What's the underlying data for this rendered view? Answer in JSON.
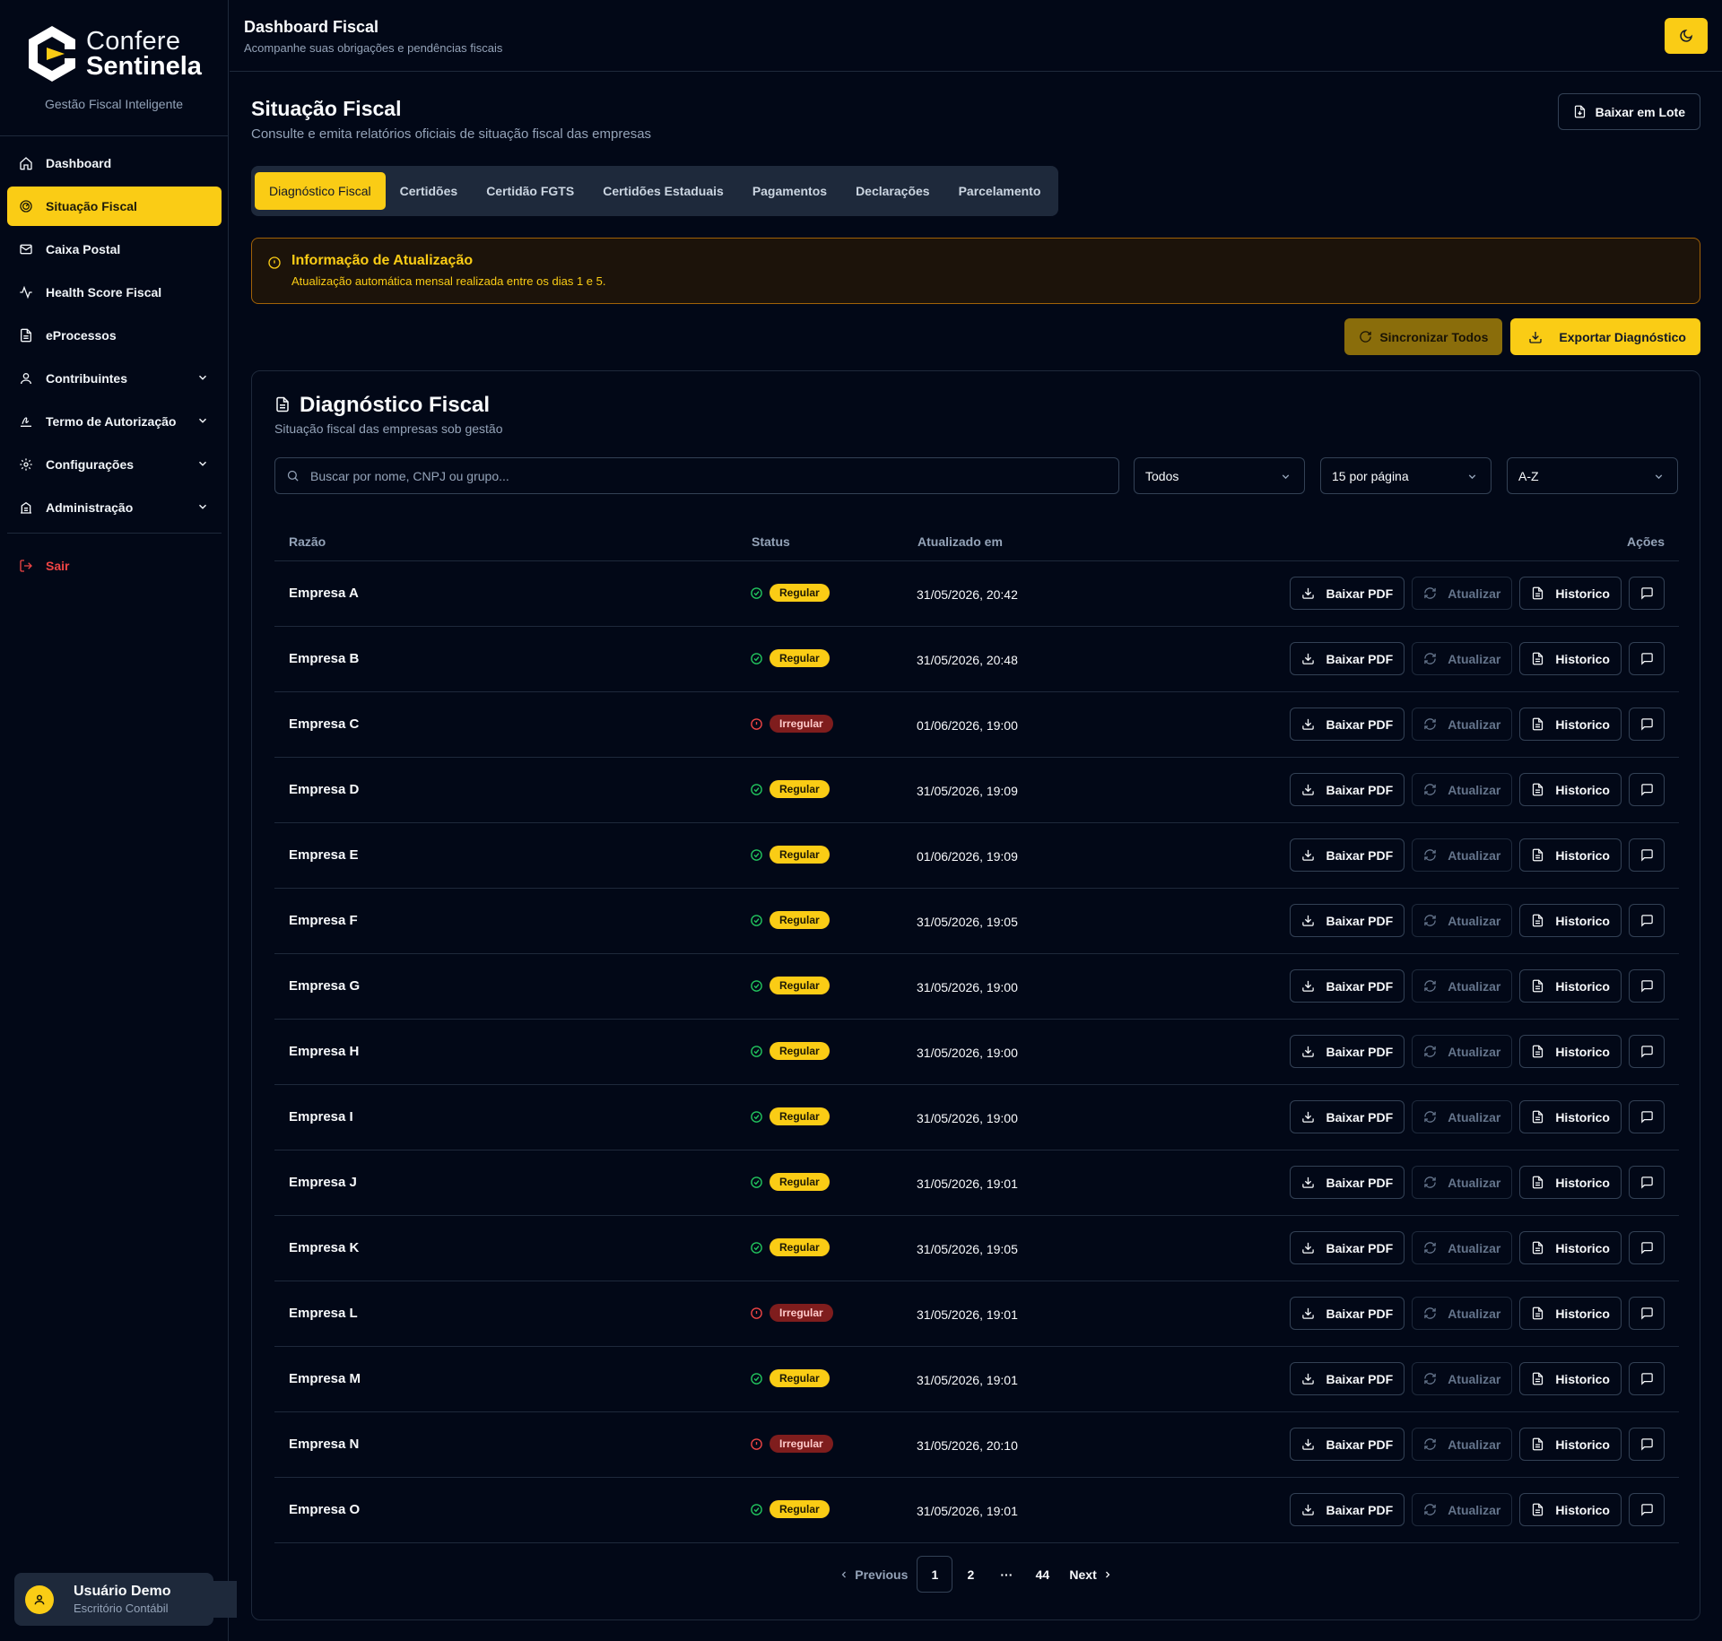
{
  "brand": {
    "line1": "Confere",
    "line2": "Sentinela",
    "tagline": "Gestão Fiscal Inteligente"
  },
  "sidebar": {
    "items": [
      {
        "label": "Dashboard",
        "icon": "home-icon"
      },
      {
        "label": "Situação Fiscal",
        "icon": "gauge-icon",
        "active": true
      },
      {
        "label": "Caixa Postal",
        "icon": "mail-icon"
      },
      {
        "label": "Health Score Fiscal",
        "icon": "activity-icon"
      },
      {
        "label": "eProcessos",
        "icon": "file-icon"
      },
      {
        "label": "Contribuintes",
        "icon": "user-icon",
        "expandable": true
      },
      {
        "label": "Termo de Autorização",
        "icon": "signature-icon",
        "expandable": true
      },
      {
        "label": "Configurações",
        "icon": "gear-icon",
        "expandable": true
      },
      {
        "label": "Administração",
        "icon": "building-icon",
        "expandable": true
      }
    ],
    "logout": "Sair"
  },
  "user": {
    "name": "Usuário Demo",
    "role": "Escritório Contábil"
  },
  "topbar": {
    "title": "Dashboard Fiscal",
    "subtitle": "Acompanhe suas obrigações e pendências fiscais"
  },
  "page": {
    "title": "Situação Fiscal",
    "subtitle": "Consulte e emita relatórios oficiais de situação fiscal das empresas",
    "batch_button": "Baixar em Lote"
  },
  "tabs": [
    "Diagnóstico Fiscal",
    "Certidões",
    "Certidão FGTS",
    "Certidões Estaduais",
    "Pagamentos",
    "Declarações",
    "Parcelamento"
  ],
  "alert": {
    "title": "Informação de Atualização",
    "text": "Atualização automática mensal realizada entre os dias 1 e 5."
  },
  "actions": {
    "sync": "Sincronizar Todos",
    "export": "Exportar Diagnóstico"
  },
  "card": {
    "title": "Diagnóstico Fiscal",
    "subtitle": "Situação fiscal das empresas sob gestão",
    "search_placeholder": "Buscar por nome, CNPJ ou grupo...",
    "filter_status": "Todos",
    "per_page": "15 por página",
    "sort": "A-Z"
  },
  "table": {
    "headers": {
      "name": "Razão",
      "status": "Status",
      "updated": "Atualizado em",
      "actions": "Ações"
    },
    "buttons": {
      "download": "Baixar PDF",
      "refresh": "Atualizar",
      "history": "Historico"
    },
    "rows": [
      {
        "name": "Empresa A",
        "status": "Regular",
        "updated": "31/05/2026, 20:42"
      },
      {
        "name": "Empresa B",
        "status": "Regular",
        "updated": "31/05/2026, 20:48"
      },
      {
        "name": "Empresa C",
        "status": "Irregular",
        "updated": "01/06/2026, 19:00"
      },
      {
        "name": "Empresa D",
        "status": "Regular",
        "updated": "31/05/2026, 19:09"
      },
      {
        "name": "Empresa E",
        "status": "Regular",
        "updated": "01/06/2026, 19:09"
      },
      {
        "name": "Empresa F",
        "status": "Regular",
        "updated": "31/05/2026, 19:05"
      },
      {
        "name": "Empresa G",
        "status": "Regular",
        "updated": "31/05/2026, 19:00"
      },
      {
        "name": "Empresa H",
        "status": "Regular",
        "updated": "31/05/2026, 19:00"
      },
      {
        "name": "Empresa I",
        "status": "Regular",
        "updated": "31/05/2026, 19:00"
      },
      {
        "name": "Empresa J",
        "status": "Regular",
        "updated": "31/05/2026, 19:01"
      },
      {
        "name": "Empresa K",
        "status": "Regular",
        "updated": "31/05/2026, 19:05"
      },
      {
        "name": "Empresa L",
        "status": "Irregular",
        "updated": "31/05/2026, 19:01"
      },
      {
        "name": "Empresa M",
        "status": "Regular",
        "updated": "31/05/2026, 19:01"
      },
      {
        "name": "Empresa N",
        "status": "Irregular",
        "updated": "31/05/2026, 20:10"
      },
      {
        "name": "Empresa O",
        "status": "Regular",
        "updated": "31/05/2026, 19:01"
      }
    ]
  },
  "pagination": {
    "previous": "Previous",
    "pages": [
      "1",
      "2"
    ],
    "ellipsis": "···",
    "last": "44",
    "next": "Next",
    "current": "1"
  },
  "colors": {
    "accent": "#facc15",
    "background": "#020817",
    "regular": "#22c55e",
    "irregular": "#ef4444"
  }
}
